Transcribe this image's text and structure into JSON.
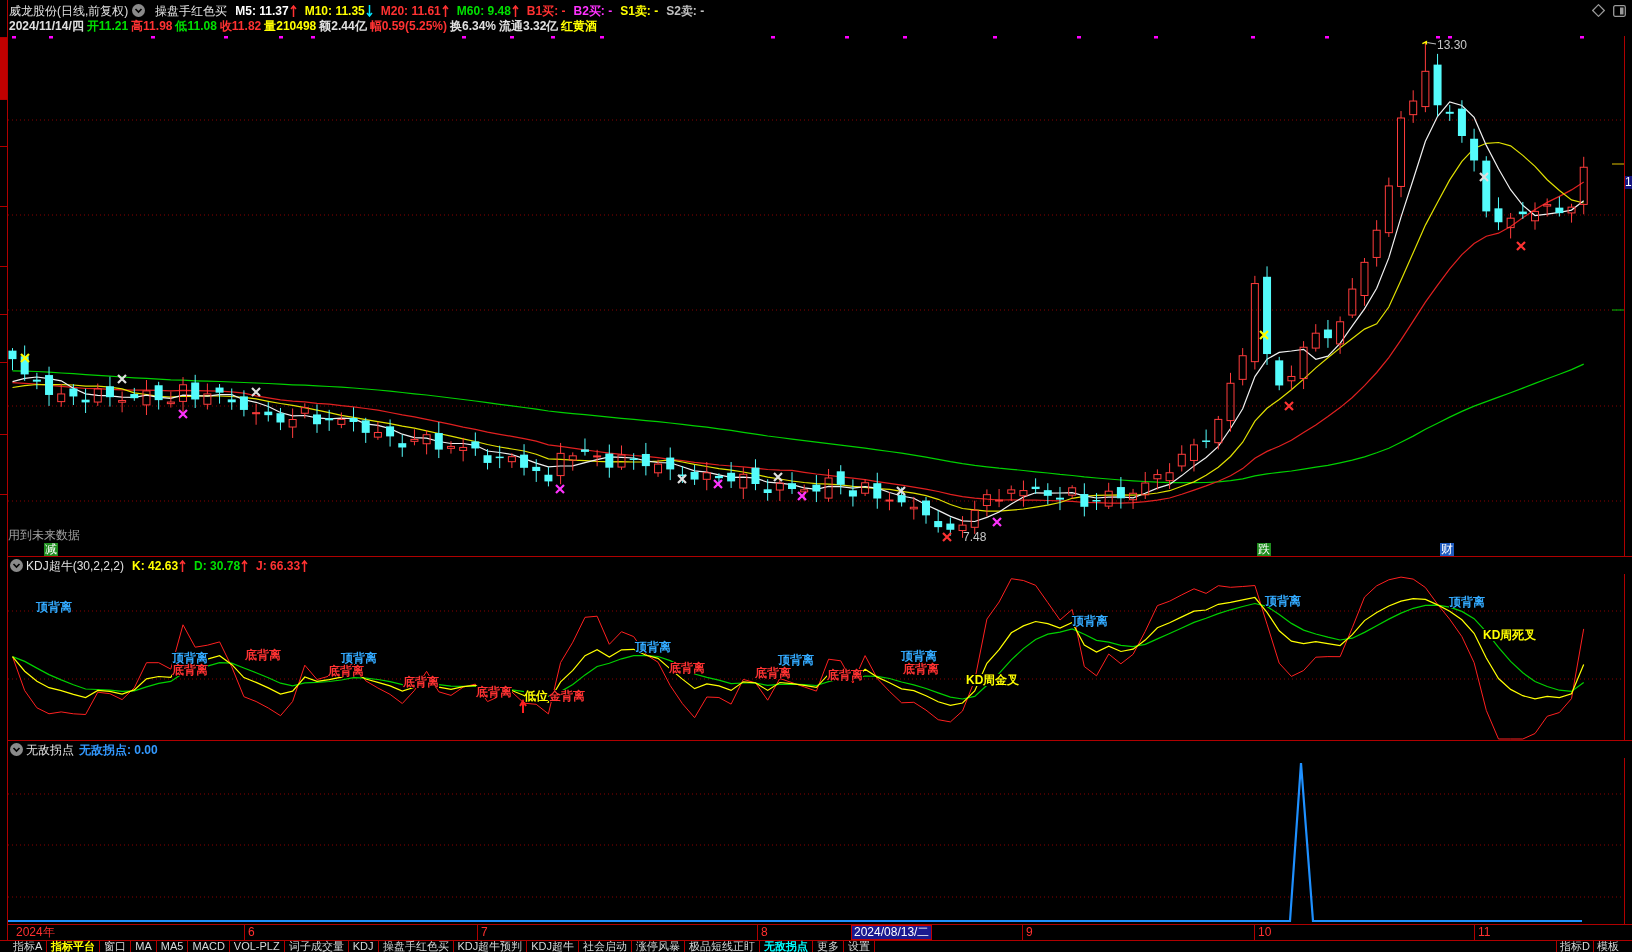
{
  "sidebar": {
    "tabs": [
      {
        "selected": false
      },
      {
        "selected": true
      },
      {
        "selected": false
      },
      {
        "selected": false
      },
      {
        "selected": false
      },
      {
        "selected": false
      },
      {
        "selected": false
      },
      {
        "selected": false
      },
      {
        "selected": false
      }
    ]
  },
  "header": {
    "title": "威龙股份(日线,前复权)",
    "indicator": "操盘手红色买",
    "averages": [
      {
        "label": "M5: 11.37",
        "kind": "rising",
        "color": "#ffffff"
      },
      {
        "label": "M10: 11.35",
        "kind": "falling",
        "color": "#ffff00"
      },
      {
        "label": "M20: 11.61",
        "kind": "rising",
        "color": "#ff3232"
      },
      {
        "label": "M60: 9.48",
        "kind": "rising",
        "color": "#00e000"
      }
    ],
    "signals": [
      {
        "label": "B1买: -",
        "color": "#ff3232"
      },
      {
        "label": "B2买: -",
        "color": "#ff32ff"
      },
      {
        "label": "S1卖: -",
        "color": "#ffff00"
      },
      {
        "label": "S2卖: -",
        "color": "#c0c0c0"
      }
    ],
    "quote": [
      {
        "label": "2024/11/14/四",
        "color": "#e0e0e0"
      },
      {
        "label": "开11.21",
        "color": "#00e000"
      },
      {
        "label": "高11.98",
        "color": "#ff3232"
      },
      {
        "label": "低11.08",
        "color": "#00e000"
      },
      {
        "label": "收11.82",
        "color": "#ff3232"
      },
      {
        "label": "量210498",
        "color": "#ffff00"
      },
      {
        "label": "额2.44亿",
        "color": "#e0e0e0"
      },
      {
        "label": "幅0.59(5.25%)",
        "color": "#ff3232"
      },
      {
        "label": "换6.34%",
        "color": "#e0e0e0"
      },
      {
        "label": "流通3.32亿",
        "color": "#e0e0e0"
      },
      {
        "label": "红黄酒",
        "color": "#ffff00"
      }
    ]
  },
  "main_chart": {
    "price_high": "13.30",
    "price_low": "7.48",
    "note": "用到未来数据",
    "price_tag": "1",
    "markers": [
      {
        "text": "减",
        "color": "#1e8c1e"
      },
      {
        "text": "跌",
        "color": "#1e8c1e"
      },
      {
        "text": "财",
        "color": "#1e5abe"
      }
    ]
  },
  "kdj_panel": {
    "title": "KDJ超牛(30,2,2,2)",
    "values": [
      {
        "label": "K: 42.63",
        "kind": "rising",
        "color": "#ffff00"
      },
      {
        "label": "D: 30.78",
        "kind": "rising",
        "color": "#00e000"
      },
      {
        "label": "J: 66.33",
        "kind": "rising",
        "color": "#ff3232"
      }
    ],
    "labels": [
      {
        "text": "顶背离",
        "color": "#33aaff"
      },
      {
        "text": "顶背离",
        "color": "#33aaff"
      },
      {
        "text": "底背离",
        "color": "#ff3232"
      },
      {
        "text": "底背离",
        "color": "#ff3232"
      },
      {
        "text": "底背离",
        "color": "#ff3232"
      },
      {
        "text": "顶背离",
        "color": "#33aaff"
      },
      {
        "text": "底背离",
        "color": "#ff3232"
      },
      {
        "text": "底背离",
        "color": "#ff3232"
      },
      {
        "text": "低位",
        "color": "#ffff00"
      },
      {
        "text": "金背离",
        "color": "#ff3232"
      },
      {
        "text": "顶背离",
        "color": "#33aaff"
      },
      {
        "text": "底背离",
        "color": "#ff3232"
      },
      {
        "text": "底背离",
        "color": "#ff3232"
      },
      {
        "text": "顶背离",
        "color": "#33aaff"
      },
      {
        "text": "底背离",
        "color": "#ff3232"
      },
      {
        "text": "顶背离",
        "color": "#33aaff"
      },
      {
        "text": "底背离",
        "color": "#ff3232"
      },
      {
        "text": "KD周金叉",
        "color": "#ffff00"
      },
      {
        "text": "顶背离",
        "color": "#33aaff"
      },
      {
        "text": "顶背离",
        "color": "#33aaff"
      },
      {
        "text": "顶背离",
        "color": "#33aaff"
      },
      {
        "text": "KD周死叉",
        "color": "#ffff00"
      }
    ]
  },
  "turning_point_panel": {
    "title": "无敌拐点",
    "value": "无敌拐点: 0.00"
  },
  "date_axis": [
    {
      "label": "2024年",
      "kind": "month"
    },
    {
      "label": "6",
      "kind": "month"
    },
    {
      "label": "7",
      "kind": "month"
    },
    {
      "label": "8",
      "kind": "month"
    },
    {
      "label": "2024/08/13/二",
      "kind": "cursor"
    },
    {
      "label": "9",
      "kind": "month"
    },
    {
      "label": "10",
      "kind": "month"
    },
    {
      "label": "11",
      "kind": "month"
    }
  ],
  "bottom_tabs": [
    {
      "label": "指标A",
      "kind": "tab",
      "selected": false
    },
    {
      "label": "指标平台",
      "kind": "platform",
      "selected": false
    },
    {
      "label": "窗口",
      "kind": "tab",
      "selected": false
    },
    {
      "label": "MA",
      "kind": "tab",
      "selected": false
    },
    {
      "label": "MA5",
      "kind": "tab",
      "selected": false
    },
    {
      "label": "MACD",
      "kind": "tab",
      "selected": false
    },
    {
      "label": "VOL-PLZ",
      "kind": "tab",
      "selected": false
    },
    {
      "label": "词子成交量",
      "kind": "tab",
      "selected": false
    },
    {
      "label": "KDJ",
      "kind": "tab",
      "selected": false
    },
    {
      "label": "操盘手红色买",
      "kind": "tab",
      "selected": false
    },
    {
      "label": "KDJ超牛预判",
      "kind": "tab",
      "selected": false
    },
    {
      "label": "KDJ超牛",
      "kind": "tab",
      "selected": false
    },
    {
      "label": "社会启动",
      "kind": "tab",
      "selected": false
    },
    {
      "label": "涨停风暴",
      "kind": "tab",
      "selected": false
    },
    {
      "label": "极品短线正盯",
      "kind": "tab",
      "selected": false
    },
    {
      "label": "无敌拐点",
      "kind": "tab",
      "selected": true
    },
    {
      "label": "更多",
      "kind": "tab",
      "selected": false
    },
    {
      "label": "设置",
      "kind": "tab",
      "selected": false
    }
  ],
  "right_tabs": [
    {
      "label": "指标D",
      "selected": false
    },
    {
      "label": "模板",
      "selected": false
    }
  ]
}
